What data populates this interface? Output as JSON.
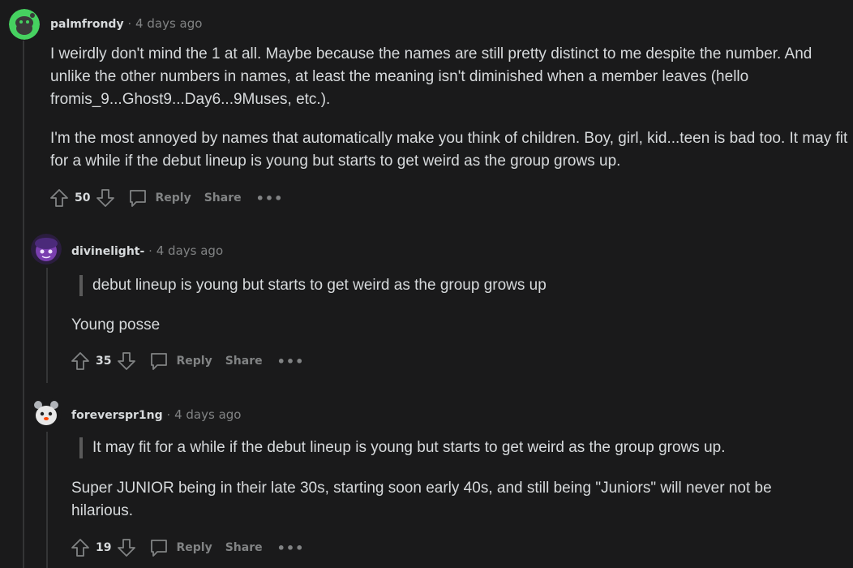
{
  "comments": [
    {
      "username": "palmfrondy",
      "timestamp": "4 days ago",
      "avatar": "snoo-green-avatar",
      "paragraphs": [
        "I weirdly don't mind the 1 at all. Maybe because the names are still pretty distinct to me despite the number. And unlike the other numbers in names, at least the meaning isn't diminished when a member leaves (hello fromis_9...Ghost9...Day6...9Muses, etc.).",
        "I'm the most annoyed by names that automatically make you think of children. Boy, girl, kid...teen is bad too. It may fit for a while if the debut lineup is young but starts to get weird as the group grows up."
      ],
      "votes": "50",
      "reply_label": "Reply",
      "share_label": "Share",
      "more_label": "•••"
    },
    {
      "username": "divinelight-",
      "timestamp": "4 days ago",
      "avatar": "purple-character-avatar",
      "quote": "debut lineup is young but starts to get weird as the group grows up",
      "paragraphs": [
        "Young posse"
      ],
      "votes": "35",
      "reply_label": "Reply",
      "share_label": "Share",
      "more_label": "•••"
    },
    {
      "username": "foreverspr1ng",
      "timestamp": "4 days ago",
      "avatar": "snoo-bear-avatar",
      "quote": "It may fit for a while if the debut lineup is young but starts to get weird as the group grows up.",
      "paragraphs": [
        "Super JUNIOR being in their late 30s, starting soon early 40s, and still being \"Juniors\" will never not be hilarious."
      ],
      "votes": "19",
      "reply_label": "Reply",
      "share_label": "Share",
      "more_label": "•••"
    }
  ],
  "separator": "·",
  "colors": {
    "background": "#1a1a1b",
    "text": "#d7dadc",
    "muted": "#818384",
    "thread_line": "#343536",
    "quote_bar": "#5a5a5a"
  }
}
